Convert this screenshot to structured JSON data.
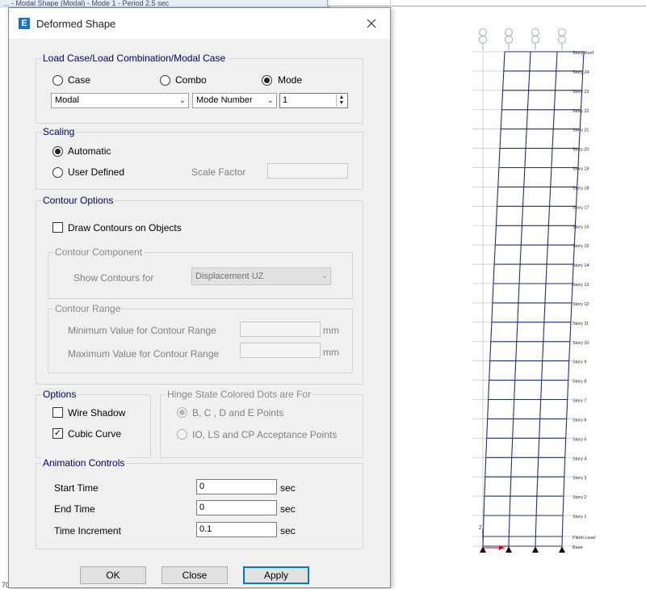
{
  "background": {
    "window_title_fragment": "... - Modal Shape (Modal) - Mode 1 - Period 2.5 sec",
    "model_color": "#1f2e7a",
    "story_labels": [
      "Story Roof",
      "Story 24",
      "Story 23",
      "Story 22",
      "Story 21",
      "Story 20",
      "Story 19",
      "Story 18",
      "Story 17",
      "Story 16",
      "Story 15",
      "Story 14",
      "Story 13",
      "Story 12",
      "Story 11",
      "Story 10",
      "Story 9",
      "Story 8",
      "Story 7",
      "Story 6",
      "Story 5",
      "Story 4",
      "Story 3",
      "Story 2",
      "Story 1",
      "Plinth Level",
      "Base"
    ],
    "axis_z": "Z",
    "axis_y": "Y",
    "status_text": "70"
  },
  "dialog": {
    "title": "Deformed Shape",
    "icon_letter": "E",
    "load_case": {
      "legend": "Load Case/Load Combination/Modal Case",
      "radio_case": "Case",
      "radio_combo": "Combo",
      "radio_mode": "Mode",
      "selected": "Mode",
      "case_select": "Modal",
      "mode_select": "Mode Number",
      "mode_value": "1"
    },
    "scaling": {
      "legend": "Scaling",
      "automatic": "Automatic",
      "user_defined": "User Defined",
      "scale_factor_label": "Scale Factor",
      "scale_factor_value": "",
      "selected": "Automatic"
    },
    "contour": {
      "legend": "Contour Options",
      "draw_label": "Draw Contours on Objects",
      "draw_checked": false,
      "component_legend": "Contour Component",
      "show_for_label": "Show Contours for",
      "show_for_value": "Displacement UZ",
      "range_legend": "Contour Range",
      "min_label": "Minimum Value for Contour Range",
      "max_label": "Maximum Value for Contour Range",
      "unit": "mm",
      "min_value": "",
      "max_value": ""
    },
    "options": {
      "legend": "Options",
      "wire_shadow": "Wire Shadow",
      "wire_shadow_checked": false,
      "cubic_curve": "Cubic Curve",
      "cubic_curve_checked": true,
      "hinge_legend": "Hinge State Colored Dots are For",
      "hinge_bcde": "B, C , D and E Points",
      "hinge_io": "IO, LS and CP Acceptance Points"
    },
    "animation": {
      "legend": "Animation Controls",
      "start_label": "Start Time",
      "start_value": "0",
      "end_label": "End Time",
      "end_value": "0",
      "inc_label": "Time Increment",
      "inc_value": "0.1",
      "unit": "sec"
    },
    "buttons": {
      "ok": "OK",
      "close": "Close",
      "apply": "Apply"
    }
  }
}
